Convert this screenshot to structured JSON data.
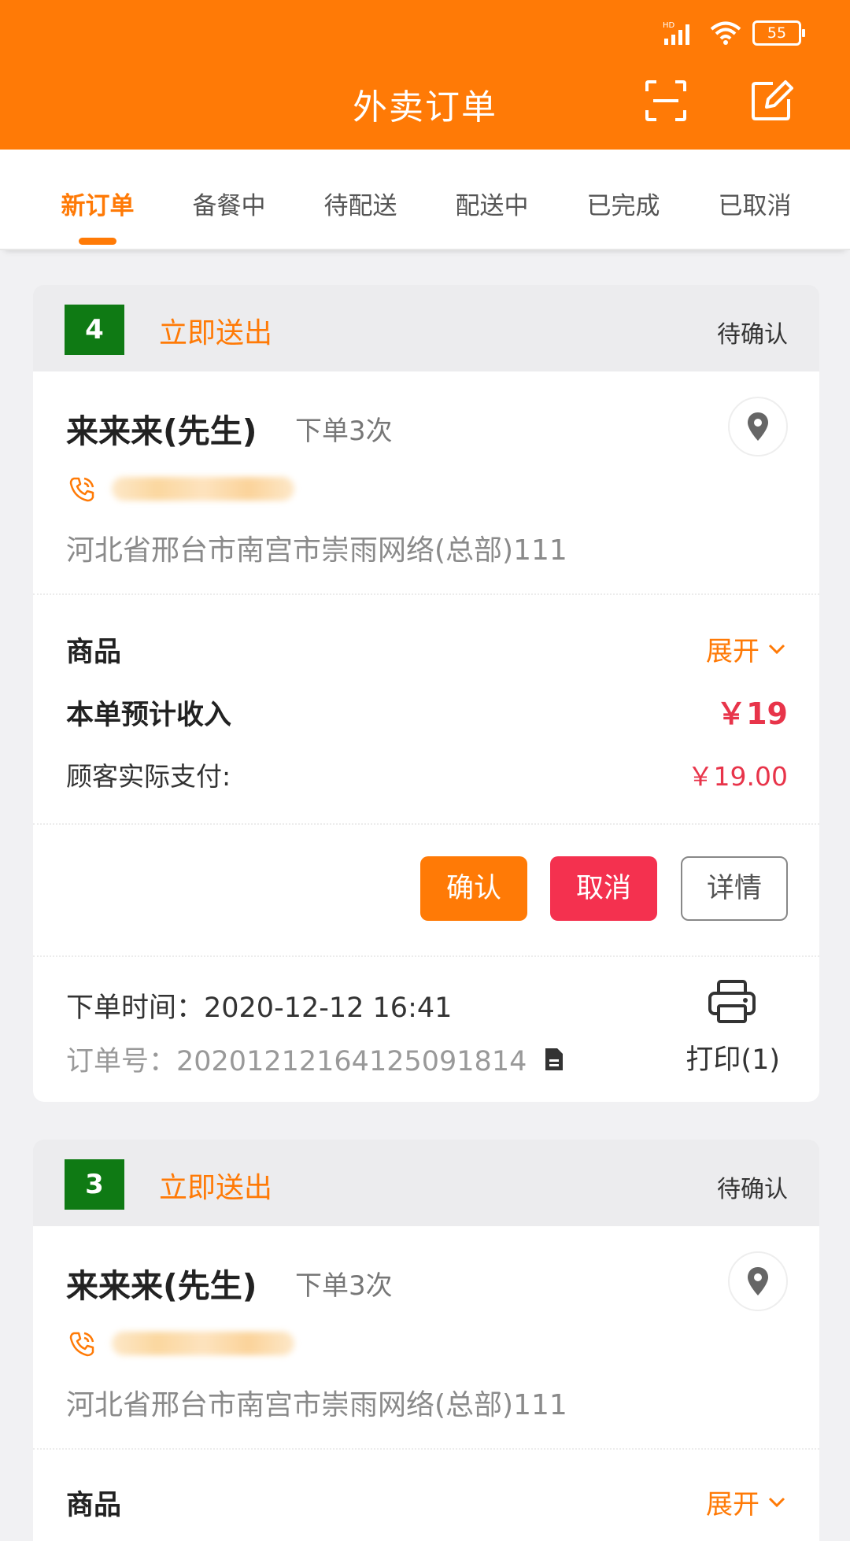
{
  "status_bar": {
    "battery": "55",
    "network": "HD"
  },
  "header": {
    "title": "外卖订单"
  },
  "tabs": [
    {
      "label": "新订单",
      "active": true
    },
    {
      "label": "备餐中",
      "active": false
    },
    {
      "label": "待配送",
      "active": false
    },
    {
      "label": "配送中",
      "active": false
    },
    {
      "label": "已完成",
      "active": false
    },
    {
      "label": "已取消",
      "active": false
    }
  ],
  "orders": [
    {
      "number": "4",
      "send_type": "立即送出",
      "status": "待确认",
      "customer": "来来来(先生)",
      "order_count": "下单3次",
      "address": "河北省邢台市南宫市崇雨网络(总部)111",
      "goods_label": "商品",
      "expand_label": "展开",
      "income_label": "本单预计收入",
      "income_value": "￥19",
      "paid_label": "顾客实际支付:",
      "paid_value": "￥19.00",
      "confirm_label": "确认",
      "cancel_label": "取消",
      "detail_label": "详情",
      "order_time": "下单时间：2020-12-12 16:41",
      "order_no": "订单号：20201212164125091814",
      "print_label": "打印(1)"
    },
    {
      "number": "3",
      "send_type": "立即送出",
      "status": "待确认",
      "customer": "来来来(先生)",
      "order_count": "下单3次",
      "address": "河北省邢台市南宫市崇雨网络(总部)111",
      "goods_label": "商品",
      "expand_label": "展开"
    }
  ],
  "colors": {
    "accent": "#ff7a06",
    "danger": "#f4314f",
    "badge": "#0f7a14",
    "price": "#e8344a"
  }
}
